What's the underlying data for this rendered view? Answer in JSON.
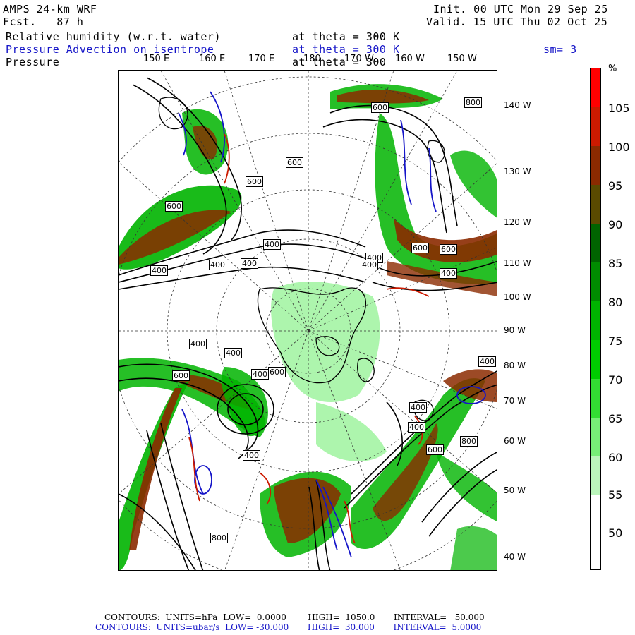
{
  "header": {
    "model": "AMPS 24-km WRF",
    "fcst": "Fcst.   87 h",
    "init": "Init. 00 UTC Mon 29 Sep 25",
    "valid": "Valid. 15 UTC Thu 02 Oct 25"
  },
  "fields": [
    {
      "name": "Relative humidity (w.r.t. water)",
      "level": "at theta = 300 K",
      "color": "#000000"
    },
    {
      "name": "Pressure Advection on isentrope",
      "level": "at theta = 300 K",
      "color": "#1515c8",
      "extra": "sm= 3"
    },
    {
      "name": "Pressure",
      "level": "at theta = 300",
      "color": "#000000"
    }
  ],
  "map": {
    "top_longitudes": [
      "150 E",
      "160 E",
      "170 E",
      "180",
      "170 W",
      "160 W",
      "150 W"
    ],
    "right_longitudes": [
      "140 W",
      "130 W",
      "120 W",
      "110 W",
      "100 W",
      "90 W",
      "80 W",
      "70 W",
      "60 W",
      "50 W",
      "40 W"
    ],
    "contour_labels": [
      "800",
      "600",
      "600",
      "600",
      "400",
      "400",
      "600",
      "400",
      "400",
      "400",
      "600",
      "600",
      "400",
      "400",
      "400",
      "400",
      "400",
      "600",
      "400",
      "400",
      "400",
      "600",
      "800",
      "800",
      "600",
      "400"
    ]
  },
  "colorbar": {
    "unit": "%",
    "labels": [
      "105",
      "100",
      "95",
      "90",
      "85",
      "80",
      "75",
      "70",
      "65",
      "60",
      "55",
      "50"
    ],
    "colors": [
      "#ff0000",
      "#cc1a00",
      "#8b2a00",
      "#5a4a00",
      "#006400",
      "#008c00",
      "#00b400",
      "#00cc00",
      "#33dd33",
      "#77ee77",
      "#bbf5bb",
      "#ffffff",
      "#ffffff"
    ]
  },
  "footer": {
    "line1": "CONTOURS:  UNITS=hPa  LOW=  0.0000        HIGH=  1050.0       INTERVAL=   50.000",
    "line2": "CONTOURS:  UNITS=ubar/s  LOW= -30.000       HIGH=  30.000       INTERVAL=  5.0000"
  }
}
